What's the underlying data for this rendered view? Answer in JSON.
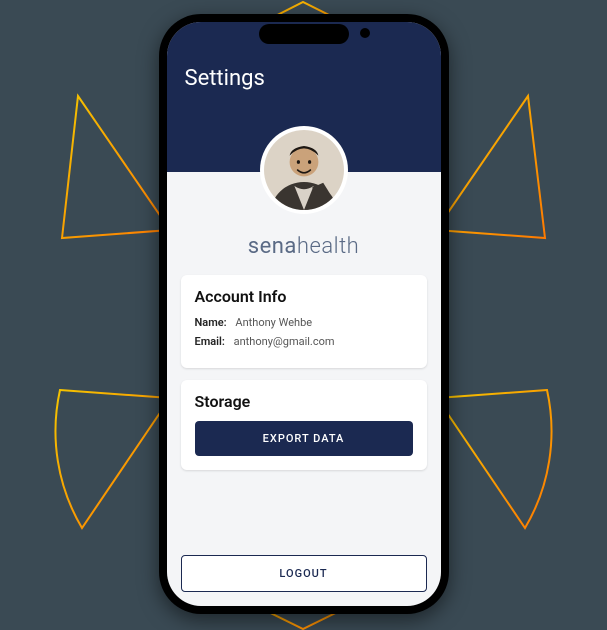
{
  "page": {
    "title": "Settings"
  },
  "brand": {
    "part1": "sena",
    "part2": "health"
  },
  "account": {
    "card_title": "Account Info",
    "name_label": "Name:",
    "name_value": "Anthony Wehbe",
    "email_label": "Email:",
    "email_value": "anthony@gmail.com"
  },
  "storage": {
    "card_title": "Storage",
    "export_label": "EXPORT DATA"
  },
  "logout_label": "LOGOUT",
  "icons": {
    "avatar": "avatar"
  }
}
